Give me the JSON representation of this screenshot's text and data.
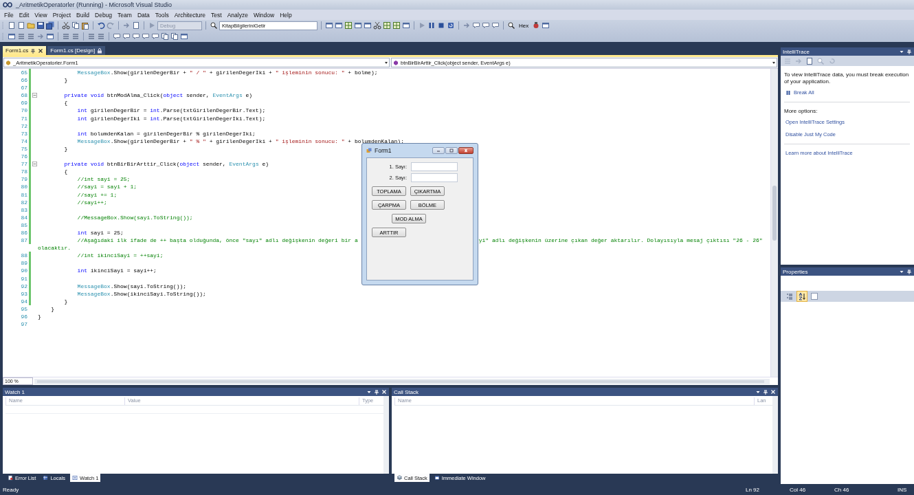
{
  "window": {
    "title": "_AritmetikOperatorler (Running) - Microsoft Visual Studio"
  },
  "menu": [
    "File",
    "Edit",
    "View",
    "Project",
    "Build",
    "Debug",
    "Team",
    "Data",
    "Tools",
    "Architecture",
    "Test",
    "Analyze",
    "Window",
    "Help"
  ],
  "toolbar": {
    "configuration": {
      "value": "Debug",
      "disabled": true
    },
    "startup_item": {
      "value": "KitapBilgileriniGetir",
      "disabled": false
    },
    "hex_button": "Hex"
  },
  "document_tabs": [
    {
      "label": "Form1.cs",
      "selected": true,
      "locked": false
    },
    {
      "label": "Form1.cs [Design]",
      "selected": false,
      "locked": true
    }
  ],
  "editor": {
    "type_dropdown": "_AritmetikOperatorler.Form1",
    "member_dropdown": "btnBirBirArttir_Click(object sender, EventArgs e)",
    "zoom": "100 %",
    "lines": [
      {
        "number": "65",
        "changed": true,
        "fold": false,
        "segments": [
          {
            "s": "            MessageBox",
            "kind": "type"
          },
          {
            "s": ".Show(girilenDegerBir + ",
            "kind": "plain"
          },
          {
            "s": "\" / \"",
            "kind": "string"
          },
          {
            "s": " + girilenDegerIki + ",
            "kind": "plain"
          },
          {
            "s": "\" işleminin sonucu: \"",
            "kind": "string"
          },
          {
            "s": " + bolme);",
            "kind": "plain"
          }
        ]
      },
      {
        "number": "66",
        "changed": true,
        "fold": false,
        "segments": [
          {
            "s": "        }",
            "kind": "plain"
          }
        ]
      },
      {
        "number": "67",
        "changed": true,
        "fold": false
      },
      {
        "number": "68",
        "changed": true,
        "fold": true,
        "segments": [
          {
            "s": "        private void",
            "kind": "keyword"
          },
          {
            "s": " btnModAlma_Click(",
            "kind": "plain"
          },
          {
            "s": "object",
            "kind": "keyword"
          },
          {
            "s": " sender, ",
            "kind": "plain"
          },
          {
            "s": "EventArgs",
            "kind": "type"
          },
          {
            "s": " e)",
            "kind": "plain"
          }
        ]
      },
      {
        "number": "69",
        "changed": true,
        "fold": false,
        "segments": [
          {
            "s": "        {",
            "kind": "plain"
          }
        ]
      },
      {
        "number": "70",
        "changed": true,
        "fold": false,
        "segments": [
          {
            "s": "            int",
            "kind": "keyword"
          },
          {
            "s": " girilenDegerBir = ",
            "kind": "plain"
          },
          {
            "s": "int",
            "kind": "keyword"
          },
          {
            "s": ".Parse(txtGirilenDegerBir.Text);",
            "kind": "plain"
          }
        ]
      },
      {
        "number": "71",
        "changed": true,
        "fold": false,
        "segments": [
          {
            "s": "            int",
            "kind": "keyword"
          },
          {
            "s": " girilenDegerIki = ",
            "kind": "plain"
          },
          {
            "s": "int",
            "kind": "keyword"
          },
          {
            "s": ".Parse(txtGirilenDegerIki.Text);",
            "kind": "plain"
          }
        ]
      },
      {
        "number": "72",
        "changed": true,
        "fold": false
      },
      {
        "number": "73",
        "changed": true,
        "fold": false,
        "segments": [
          {
            "s": "            int",
            "kind": "keyword"
          },
          {
            "s": " bolumdenKalan = girilenDegerBir % girilenDegerIki;",
            "kind": "plain"
          }
        ]
      },
      {
        "number": "74",
        "changed": true,
        "fold": false,
        "segments": [
          {
            "s": "            MessageBox",
            "kind": "type"
          },
          {
            "s": ".Show(girilenDegerBir + ",
            "kind": "plain"
          },
          {
            "s": "\" % \"",
            "kind": "string"
          },
          {
            "s": " + girilenDegerIki + ",
            "kind": "plain"
          },
          {
            "s": "\" işleminin sonucu: \"",
            "kind": "string"
          },
          {
            "s": " + bolumdenKalan);",
            "kind": "plain"
          }
        ]
      },
      {
        "number": "75",
        "changed": true,
        "fold": false,
        "segments": [
          {
            "s": "        }",
            "kind": "plain"
          }
        ]
      },
      {
        "number": "76",
        "changed": true,
        "fold": false
      },
      {
        "number": "77",
        "changed": true,
        "fold": true,
        "segments": [
          {
            "s": "        private void",
            "kind": "keyword"
          },
          {
            "s": " btnBirBirArttir_Click(",
            "kind": "plain"
          },
          {
            "s": "object",
            "kind": "keyword"
          },
          {
            "s": " sender, ",
            "kind": "plain"
          },
          {
            "s": "EventArgs",
            "kind": "type"
          },
          {
            "s": " e)",
            "kind": "plain"
          }
        ]
      },
      {
        "number": "78",
        "changed": true,
        "fold": false,
        "segments": [
          {
            "s": "        {",
            "kind": "plain"
          }
        ]
      },
      {
        "number": "79",
        "changed": true,
        "fold": false,
        "segments": [
          {
            "s": "            //int sayi = 25;",
            "kind": "comment"
          }
        ]
      },
      {
        "number": "80",
        "changed": true,
        "fold": false,
        "segments": [
          {
            "s": "            //sayi = sayi + 1;",
            "kind": "comment"
          }
        ]
      },
      {
        "number": "81",
        "changed": true,
        "fold": false,
        "segments": [
          {
            "s": "            //sayi += 1;",
            "kind": "comment"
          }
        ]
      },
      {
        "number": "82",
        "changed": true,
        "fold": false,
        "segments": [
          {
            "s": "            //sayi++;",
            "kind": "comment"
          }
        ]
      },
      {
        "number": "83",
        "changed": true,
        "fold": false
      },
      {
        "number": "84",
        "changed": true,
        "fold": false,
        "segments": [
          {
            "s": "            //MessageBox.Show(sayi.ToString());",
            "kind": "comment"
          }
        ]
      },
      {
        "number": "85",
        "changed": true,
        "fold": false
      },
      {
        "number": "86",
        "changed": true,
        "fold": false,
        "segments": [
          {
            "s": "            int",
            "kind": "keyword"
          },
          {
            "s": " sayi = 25;",
            "kind": "plain"
          }
        ]
      },
      {
        "number": "87",
        "changed": true,
        "fold": false,
        "segments": [
          {
            "s": "            //Aşağıdaki ilk ifade de ++ başta olduğunda, önce \"sayı\" adlı değişkenin değeri bir a",
            "kind": "comment"
          }
        ],
        "after_form": [
          {
            "s": "yi\" adlı değişkenin üzerine çıkan değer aktarılır. Dolayısıyla mesaj çıktısı \"26 - 26\"",
            "kind": "comment"
          }
        ],
        "wrap": "olacaktır."
      },
      {
        "number": "88",
        "changed": true,
        "fold": false,
        "segments": [
          {
            "s": "            //int ikinciSayi = ++sayi;",
            "kind": "comment"
          }
        ]
      },
      {
        "number": "89",
        "changed": true,
        "fold": false
      },
      {
        "number": "90",
        "changed": true,
        "fold": false,
        "segments": [
          {
            "s": "            int",
            "kind": "keyword"
          },
          {
            "s": " ikinciSayi = sayi++;",
            "kind": "plain"
          }
        ]
      },
      {
        "number": "91",
        "changed": true,
        "fold": false
      },
      {
        "number": "92",
        "changed": true,
        "fold": false,
        "segments": [
          {
            "s": "            MessageBox",
            "kind": "type"
          },
          {
            "s": ".Show(sayi.ToString());",
            "kind": "plain"
          }
        ]
      },
      {
        "number": "93",
        "changed": true,
        "fold": false,
        "segments": [
          {
            "s": "            MessageBox",
            "kind": "type"
          },
          {
            "s": ".Show(ikinciSayi.ToString());",
            "kind": "plain"
          }
        ]
      },
      {
        "number": "94",
        "changed": true,
        "fold": false,
        "segments": [
          {
            "s": "        }",
            "kind": "plain"
          }
        ]
      },
      {
        "number": "95",
        "changed": false,
        "fold": false,
        "segments": [
          {
            "s": "    }",
            "kind": "plain"
          }
        ]
      },
      {
        "number": "96",
        "changed": false,
        "fold": false,
        "segments": [
          {
            "s": "}",
            "kind": "plain"
          }
        ]
      },
      {
        "number": "97",
        "changed": false,
        "fold": false
      }
    ]
  },
  "running_form": {
    "title": "Form1",
    "fields": [
      {
        "label": "1. Sayı:"
      },
      {
        "label": "2. Sayı:"
      }
    ],
    "button_rows": [
      {
        "kind": "flush",
        "buttons": [
          "TOPLAMA",
          "ÇIKARTMA"
        ]
      },
      {
        "kind": "flush",
        "buttons": [
          "ÇARPMA",
          "BÖLME"
        ]
      },
      {
        "kind": "centered",
        "buttons": [
          "MOD ALMA"
        ]
      },
      {
        "kind": "flush",
        "buttons": [
          "ARTTIR"
        ]
      }
    ]
  },
  "intellitrace": {
    "title": "IntelliTrace",
    "message": "To view IntelliTrace data, you must break execution of your application.",
    "break_all": "Break All",
    "more_options": "More options:",
    "links": [
      "Open IntelliTrace Settings",
      "Disable Just My Code"
    ],
    "learn_more": "Learn more about IntelliTrace"
  },
  "properties": {
    "title": "Properties",
    "sort_buttons": [
      {
        "kind": "categorized",
        "selected": false
      },
      {
        "kind": "alphabetical",
        "selected": true
      },
      {
        "kind": "pages",
        "selected": false
      }
    ]
  },
  "watch": {
    "title": "Watch 1",
    "columns": [
      "Name",
      "Value",
      "Type"
    ],
    "tabs": [
      {
        "kind": "errors",
        "label": "Error List",
        "selected": false
      },
      {
        "kind": "locals",
        "label": "Locals",
        "selected": false
      },
      {
        "kind": "watch",
        "label": "Watch 1",
        "selected": true
      }
    ]
  },
  "call_stack": {
    "title": "Call Stack",
    "columns": [
      "Name",
      "Lan"
    ],
    "tabs": [
      {
        "kind": "callstack",
        "label": "Call Stack",
        "selected": true
      },
      {
        "kind": "immediate",
        "label": "Immediate Window",
        "selected": false
      }
    ]
  },
  "status_bar": {
    "message": "Ready",
    "line": "Ln 92",
    "column": "Col 46",
    "char": "Ch 46",
    "mode": "INS"
  }
}
